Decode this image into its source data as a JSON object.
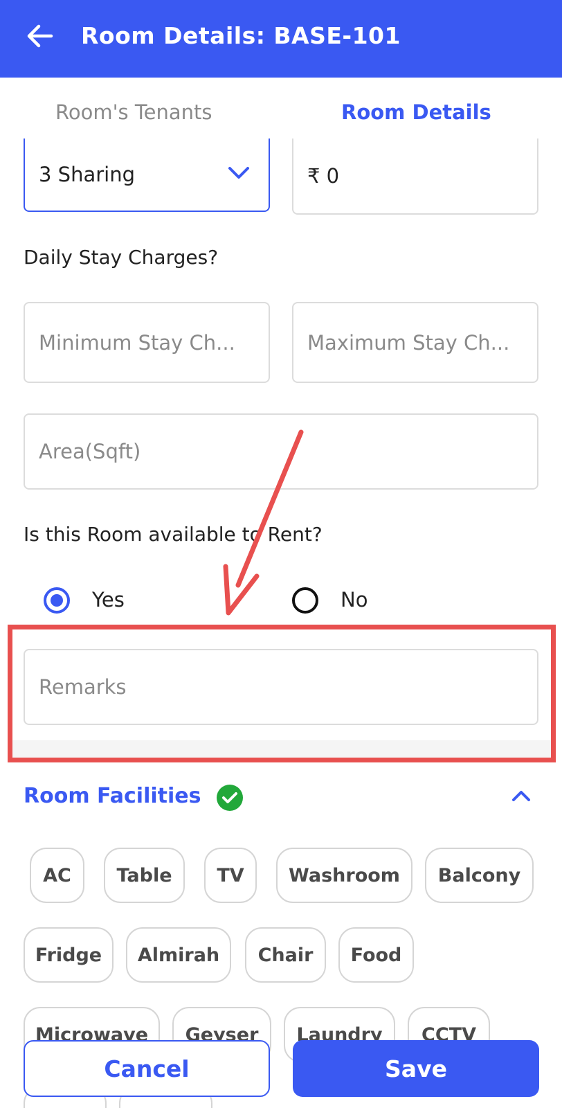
{
  "appbar": {
    "title": "Room Details: BASE-101",
    "back_icon": "arrow-left-icon",
    "bg_color": "#3a59f2"
  },
  "tabs": [
    {
      "label": "Room's Tenants",
      "active": false
    },
    {
      "label": "Room Details",
      "active": true
    }
  ],
  "form": {
    "sharing": {
      "value": "3 Sharing",
      "icon": "chevron-down-icon"
    },
    "rent": {
      "value": "₹ 0"
    },
    "daily_stay_label": "Daily Stay Charges?",
    "min_stay": {
      "placeholder": "Minimum Stay Ch..."
    },
    "max_stay": {
      "placeholder": "Maximum Stay Ch..."
    },
    "area": {
      "placeholder": "Area(Sqft)"
    },
    "available_label": "Is this Room available to Rent?",
    "available_options": [
      {
        "label": "Yes",
        "selected": true
      },
      {
        "label": "No",
        "selected": false
      }
    ],
    "remarks": {
      "placeholder": "Remarks"
    }
  },
  "facilities": {
    "title": "Room Facilities",
    "status_icon": "check-circle-icon",
    "toggle_icon": "chevron-up-icon",
    "items": [
      "AC",
      "Table",
      "TV",
      "Washroom",
      "Balcony",
      "Fridge",
      "Almirah",
      "Chair",
      "Food",
      "Microwave",
      "Geyser",
      "Laundry",
      "CCTV"
    ]
  },
  "footer": {
    "cancel_label": "Cancel",
    "save_label": "Save"
  },
  "annotation": {
    "color": "#e8504f"
  }
}
